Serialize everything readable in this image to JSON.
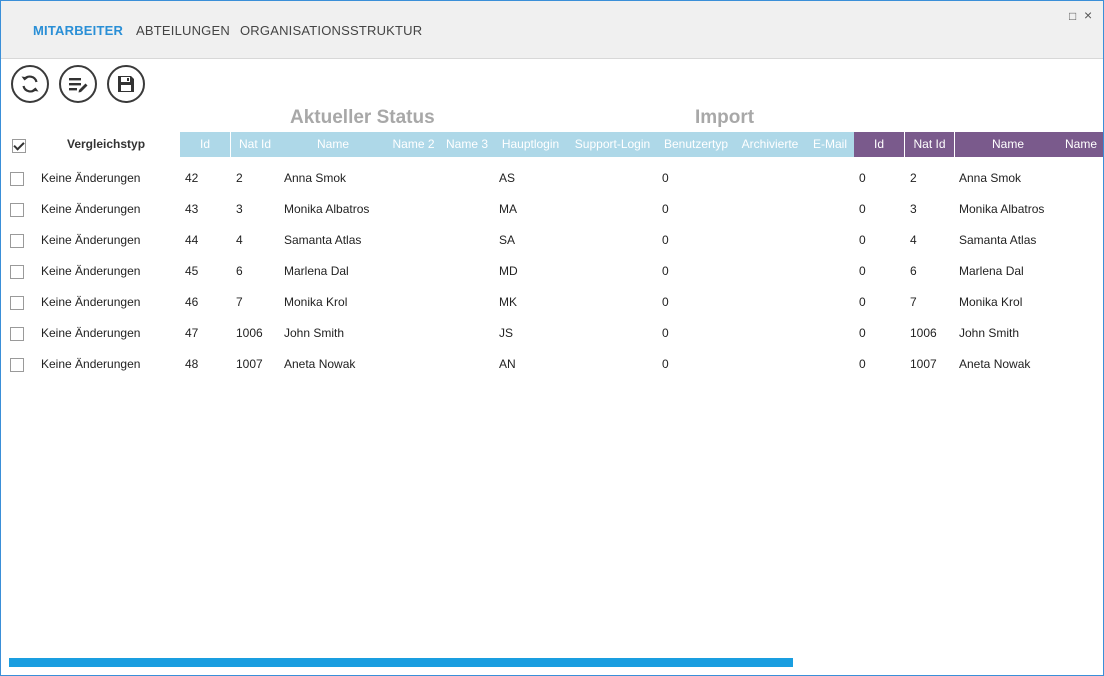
{
  "tabs": [
    {
      "label": "MITARBEITER",
      "active": true
    },
    {
      "label": "ABTEILUNGEN",
      "active": false
    },
    {
      "label": "ORGANISATIONSSTRUKTUR",
      "active": false
    }
  ],
  "window_controls": {
    "maximize": "□",
    "close": "×"
  },
  "toolbar": {
    "refresh_icon": "refresh-icon",
    "edit_icon": "edit-list-icon",
    "save_icon": "save-icon"
  },
  "groups": {
    "current": "Aktueller Status",
    "import": "Import"
  },
  "compare_header": "Vergleichstyp",
  "select_all_checked": true,
  "columns_current": [
    "Id",
    "Nat Id",
    "Name",
    "Name 2",
    "Name 3",
    "Hauptlogin",
    "Support-Login",
    "Benutzertyp",
    "Archivierte",
    "E-Mail"
  ],
  "columns_import": [
    "Id",
    "Nat Id",
    "Name",
    "Name"
  ],
  "rows": [
    {
      "type": "Keine Änderungen",
      "id": "42",
      "nat_id": "2",
      "name": "Anna Smok",
      "hauptlogin": "AS",
      "benutzertyp": "0",
      "imp_id": "0",
      "imp_nat_id": "2",
      "imp_name": "Anna Smok"
    },
    {
      "type": "Keine Änderungen",
      "id": "43",
      "nat_id": "3",
      "name": "Monika Albatros",
      "hauptlogin": "MA",
      "benutzertyp": "0",
      "imp_id": "0",
      "imp_nat_id": "3",
      "imp_name": "Monika Albatros"
    },
    {
      "type": "Keine Änderungen",
      "id": "44",
      "nat_id": "4",
      "name": "Samanta Atlas",
      "hauptlogin": "SA",
      "benutzertyp": "0",
      "imp_id": "0",
      "imp_nat_id": "4",
      "imp_name": "Samanta Atlas"
    },
    {
      "type": "Keine Änderungen",
      "id": "45",
      "nat_id": "6",
      "name": "Marlena Dal",
      "hauptlogin": "MD",
      "benutzertyp": "0",
      "imp_id": "0",
      "imp_nat_id": "6",
      "imp_name": "Marlena Dal"
    },
    {
      "type": "Keine Änderungen",
      "id": "46",
      "nat_id": "7",
      "name": "Monika Krol",
      "hauptlogin": "MK",
      "benutzertyp": "0",
      "imp_id": "0",
      "imp_nat_id": "7",
      "imp_name": "Monika Krol"
    },
    {
      "type": "Keine Änderungen",
      "id": "47",
      "nat_id": "1006",
      "name": "John Smith",
      "hauptlogin": "JS",
      "benutzertyp": "0",
      "imp_id": "0",
      "imp_nat_id": "1006",
      "imp_name": "John Smith"
    },
    {
      "type": "Keine Änderungen",
      "id": "48",
      "nat_id": "1007",
      "name": "Aneta Nowak",
      "hauptlogin": "AN",
      "benutzertyp": "0",
      "imp_id": "0",
      "imp_nat_id": "1007",
      "imp_name": "Aneta Nowak"
    }
  ],
  "colors": {
    "accent": "#2a8fd6",
    "header_current": "#aed8e8",
    "header_import": "#7a5a8c",
    "scrollbar": "#1a9ee0"
  }
}
